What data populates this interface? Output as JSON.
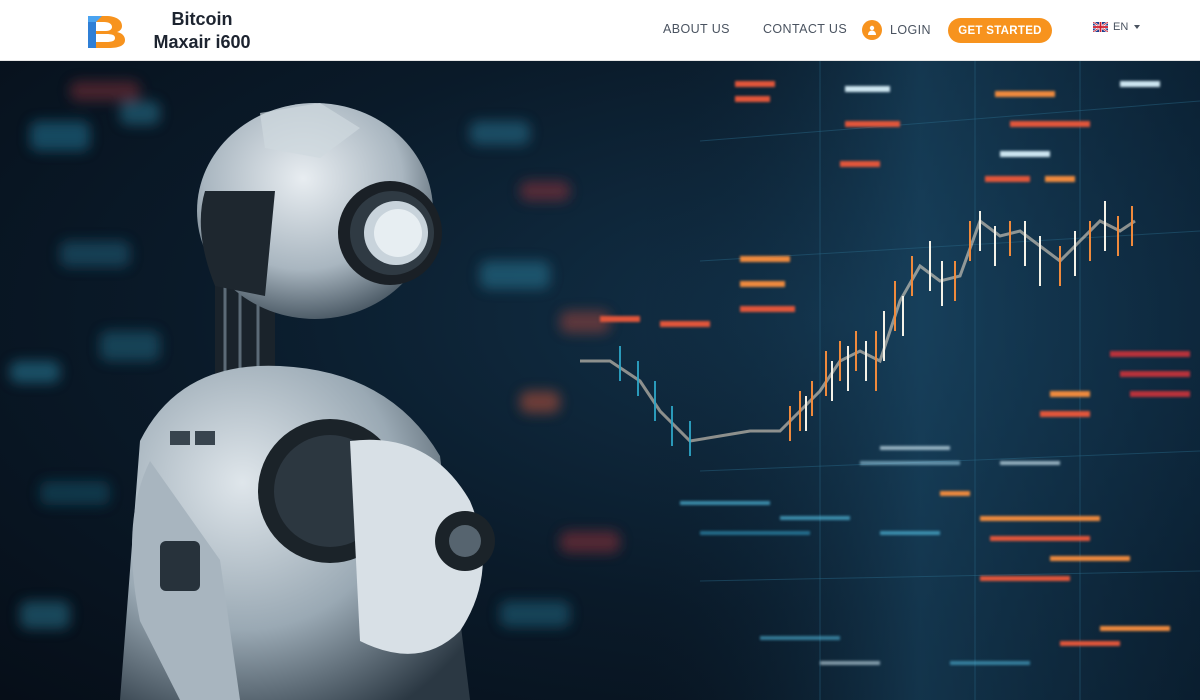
{
  "header": {
    "brand_line1": "Bitcoin",
    "brand_line2": "Maxair i600",
    "nav": {
      "about": "ABOUT US",
      "contact": "CONTACT US",
      "login": "LOGIN",
      "cta": "GET STARTED",
      "language": "EN"
    }
  },
  "icons": {
    "logo": "brand-logo-icon",
    "login": "user-icon",
    "flag": "uk-flag-icon",
    "caret": "caret-down-icon"
  },
  "colors": {
    "accent": "#f7931e",
    "header_bg": "#ffffff",
    "nav_text": "#4a5360",
    "brand_text": "#1d2430"
  },
  "hero": {
    "image": "robot looking at trading chart screens"
  }
}
